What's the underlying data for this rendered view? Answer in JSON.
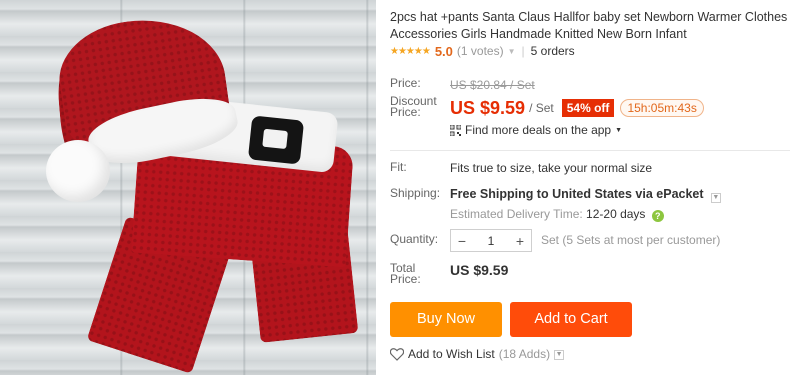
{
  "product": {
    "title": "2pcs hat +pants Santa Claus Hallfor baby set Newborn Warmer Clothes Accessories Girls Handmade Knitted New Born Infant",
    "rating": {
      "stars_icon": "star-rating-icon",
      "stars_glyphs": "★★★★★",
      "score": "5.0",
      "votes": "(1 votes)",
      "orders": "5 orders"
    }
  },
  "price": {
    "label": "Price:",
    "original": "US $20.84 / Set",
    "discount_label_line1": "Discount",
    "discount_label_line2": "Price:",
    "current": "US $9.59",
    "unit": "/ Set",
    "discount_badge": "54% off",
    "timer": "15h:05m:43s",
    "deals_text": "Find more deals on the app",
    "accent_color": "#e62e04"
  },
  "fit": {
    "label": "Fit:",
    "value": "Fits true to size, take your normal size"
  },
  "shipping": {
    "label": "Shipping:",
    "value": "Free Shipping to United States via ePacket",
    "delivery_label": "Estimated Delivery Time:",
    "delivery_value": "12-20 days"
  },
  "quantity": {
    "label": "Quantity:",
    "minus": "−",
    "value": "1",
    "plus": "+",
    "note": "Set (5 Sets at most per customer)"
  },
  "total": {
    "label_line1": "Total",
    "label_line2": "Price:",
    "value": "US $9.59"
  },
  "actions": {
    "buy_now": "Buy Now",
    "add_to_cart": "Add to Cart",
    "buy_color": "#ff9000",
    "cart_color": "#ff4c0a"
  },
  "wishlist": {
    "label": "Add to Wish List",
    "count": "(18 Adds)"
  }
}
